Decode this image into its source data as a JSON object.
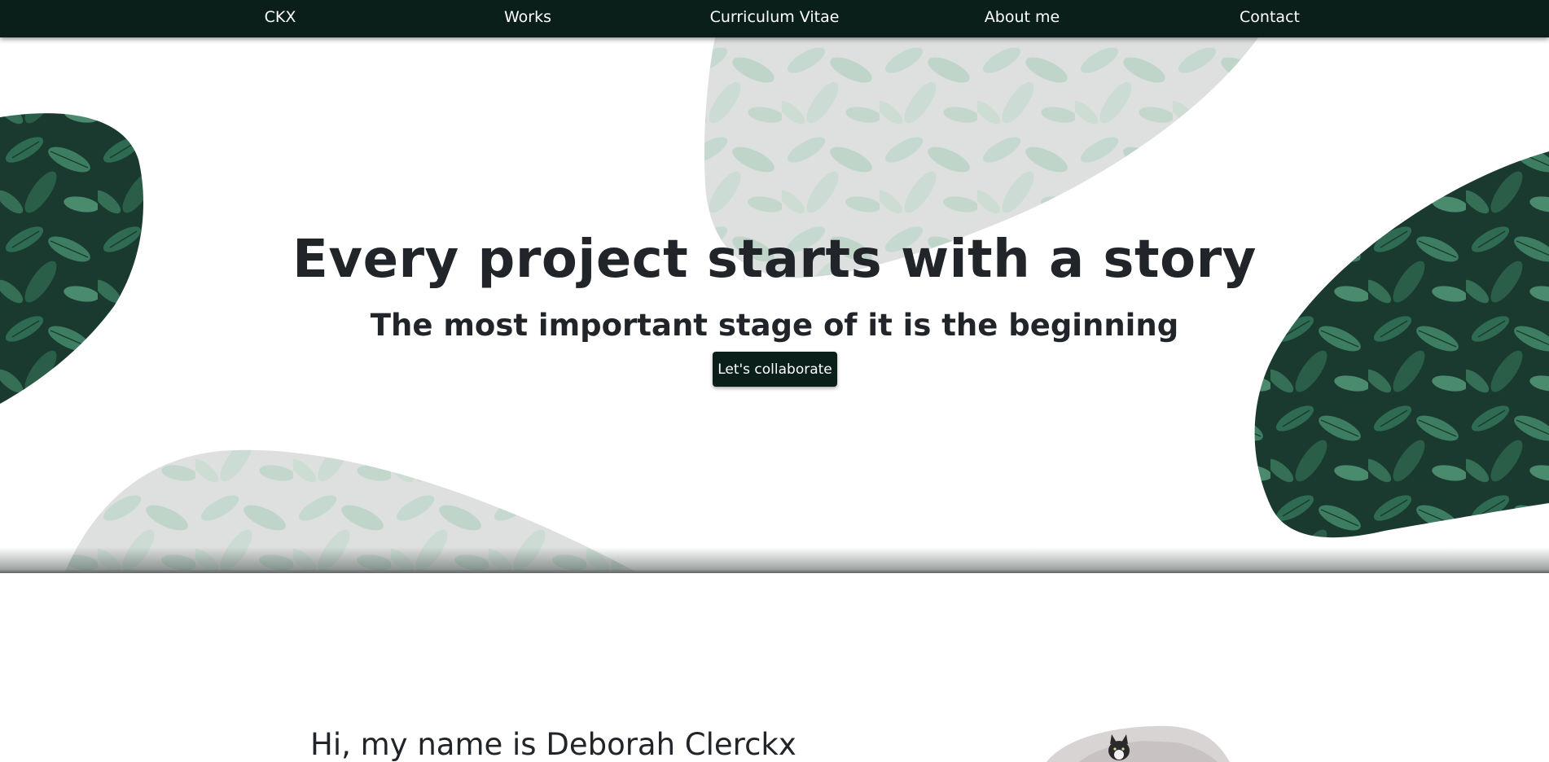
{
  "nav": {
    "items": [
      {
        "label": "CKX"
      },
      {
        "label": "Works"
      },
      {
        "label": "Curriculum Vitae"
      },
      {
        "label": "About me"
      },
      {
        "label": "Contact"
      }
    ]
  },
  "hero": {
    "title": "Every project starts with a story",
    "subtitle": "The most important stage of it is the beginning",
    "cta_label": "Let's collaborate"
  },
  "intro": {
    "heading": "Hi, my name is Deborah Clerckx"
  },
  "colors": {
    "nav_background": "#0b1f1a",
    "button_background": "#0b1f1a",
    "text": "#212529",
    "leaf_dark": "#1c3a30",
    "leaf_light": "#3f7a60"
  }
}
